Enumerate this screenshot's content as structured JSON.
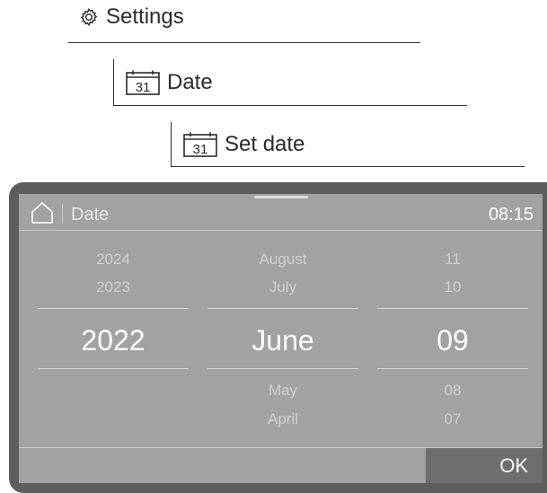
{
  "breadcrumb": {
    "level1": {
      "icon": "gear-icon",
      "label": "Settings"
    },
    "level2": {
      "icon": "calendar-icon",
      "label": "Date",
      "icon_text": "31"
    },
    "level3": {
      "icon": "calendar-icon",
      "label": "Set date",
      "icon_text": "31"
    }
  },
  "screen": {
    "header": {
      "home_icon": "home-icon",
      "title": "Date",
      "time": "08:15"
    },
    "pickers": {
      "year": {
        "above": [
          "2024",
          "2023"
        ],
        "selected": "2022",
        "below": []
      },
      "month": {
        "above": [
          "August",
          "July"
        ],
        "selected": "June",
        "below": [
          "May",
          "April"
        ]
      },
      "day": {
        "above": [
          "11",
          "10"
        ],
        "selected": "09",
        "below": [
          "08",
          "07"
        ]
      }
    },
    "footer": {
      "ok_label": "OK"
    }
  },
  "colors": {
    "screen_bg": "#a2a2a2",
    "bezel": "#5e5e5e",
    "ok_bg": "#6e6e6e",
    "text_selected": "#ffffff"
  }
}
